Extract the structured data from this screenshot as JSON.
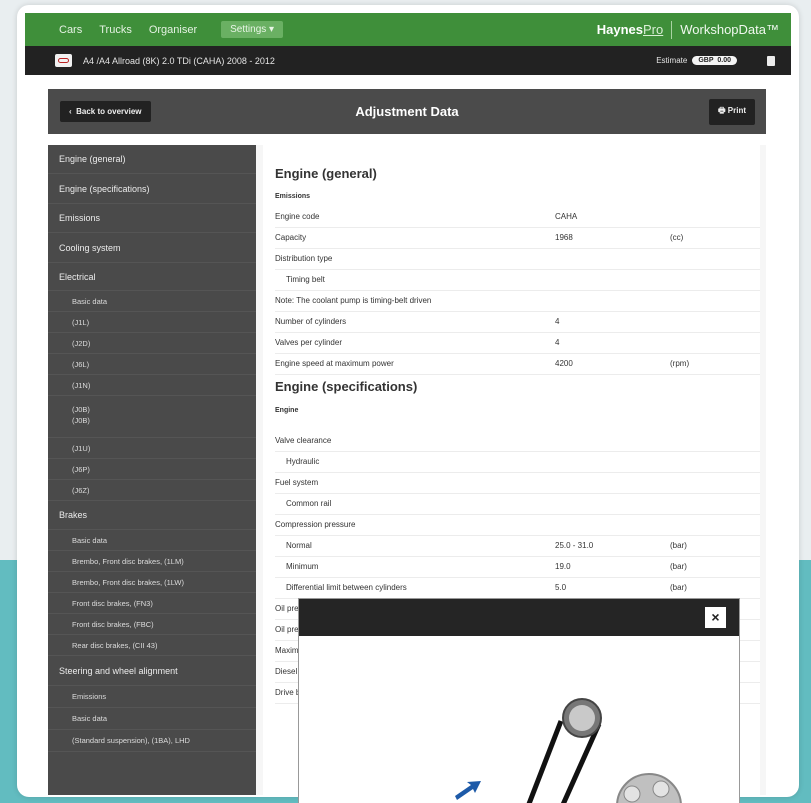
{
  "topnav": {
    "items": [
      "Cars",
      "Trucks",
      "Organiser"
    ],
    "settings_label": "Settings",
    "brand_haynes": "Haynes",
    "brand_pro": "Pro",
    "brand_workshop": "WorkshopData™"
  },
  "vehicle": {
    "title": "A4 /A4 Allroad (8K) 2.0 TDi (CAHA) 2008 - 2012",
    "estimate_label": "Estimate",
    "estimate_currency": "GBP",
    "estimate_value": "0.00"
  },
  "adjust": {
    "back_label": "Back to overview",
    "title": "Adjustment Data",
    "print_label": "Print"
  },
  "sidebar": {
    "items": [
      "Engine (general)",
      "Engine (specifications)",
      "Emissions",
      "Cooling system",
      "Electrical",
      "Basic data",
      "(J1L)",
      "(J2D)",
      "(J6L)",
      "(J1N)",
      "(J0B)",
      "(J0B)",
      "(J1U)",
      "(J6P)",
      "(J6Z)",
      "Brakes",
      "Basic data",
      "Brembo, Front disc brakes, (1LM)",
      "Brembo, Front disc brakes, (1LW)",
      "Front disc brakes, (FN3)",
      "Front disc brakes, (FBC)",
      "Rear disc brakes, (CII 43)",
      "Steering and wheel alignment",
      "Emissions",
      "Basic data",
      "(Standard suspension), (1BA), LHD"
    ]
  },
  "content": {
    "section1_title": "Engine (general)",
    "section1_sub": "Emissions",
    "rows1": [
      {
        "label": "Engine code",
        "value": "CAHA",
        "unit": ""
      },
      {
        "label": "Capacity",
        "value": "1968",
        "unit": "(cc)"
      },
      {
        "label": "Distribution type",
        "value": "",
        "unit": ""
      },
      {
        "label": "Timing belt",
        "value": "",
        "unit": ""
      },
      {
        "label": "Note: The coolant pump is timing-belt driven",
        "value": "",
        "unit": ""
      },
      {
        "label": "Number of cylinders",
        "value": "4",
        "unit": ""
      },
      {
        "label": "Valves per cylinder",
        "value": "4",
        "unit": ""
      },
      {
        "label": "Engine speed at maximum power",
        "value": "4200",
        "unit": "(rpm)"
      }
    ],
    "section2_title": "Engine (specifications)",
    "section2_sub": "Engine",
    "rows2": [
      {
        "label": "Valve clearance",
        "value": "",
        "unit": ""
      },
      {
        "label": "Hydraulic",
        "value": "",
        "unit": ""
      },
      {
        "label": "Fuel system",
        "value": "",
        "unit": ""
      },
      {
        "label": "Common rail",
        "value": "",
        "unit": ""
      },
      {
        "label": "Compression pressure",
        "value": "",
        "unit": ""
      },
      {
        "label": "Normal",
        "value": "25.0 - 31.0",
        "unit": "(bar)"
      },
      {
        "label": "Minimum",
        "value": "19.0",
        "unit": "(bar)"
      },
      {
        "label": "Differential limit between cylinders",
        "value": "5.0",
        "unit": "(bar)"
      },
      {
        "label": "Oil pres",
        "value": "",
        "unit": ""
      },
      {
        "label": "Oil pres",
        "value": "",
        "unit": ""
      },
      {
        "label": "Maximu",
        "value": "",
        "unit": ""
      },
      {
        "label": "Diesel p",
        "value": "",
        "unit": ""
      },
      {
        "label": "Drive be",
        "value": "",
        "unit": ""
      }
    ]
  },
  "modal": {
    "close_label": "×"
  },
  "colors": {
    "nav_green": "#3f8f3a",
    "dark_bar": "#222222",
    "sidebar_gray": "#4a4a4a",
    "teal_bg": "#62bcc0"
  }
}
